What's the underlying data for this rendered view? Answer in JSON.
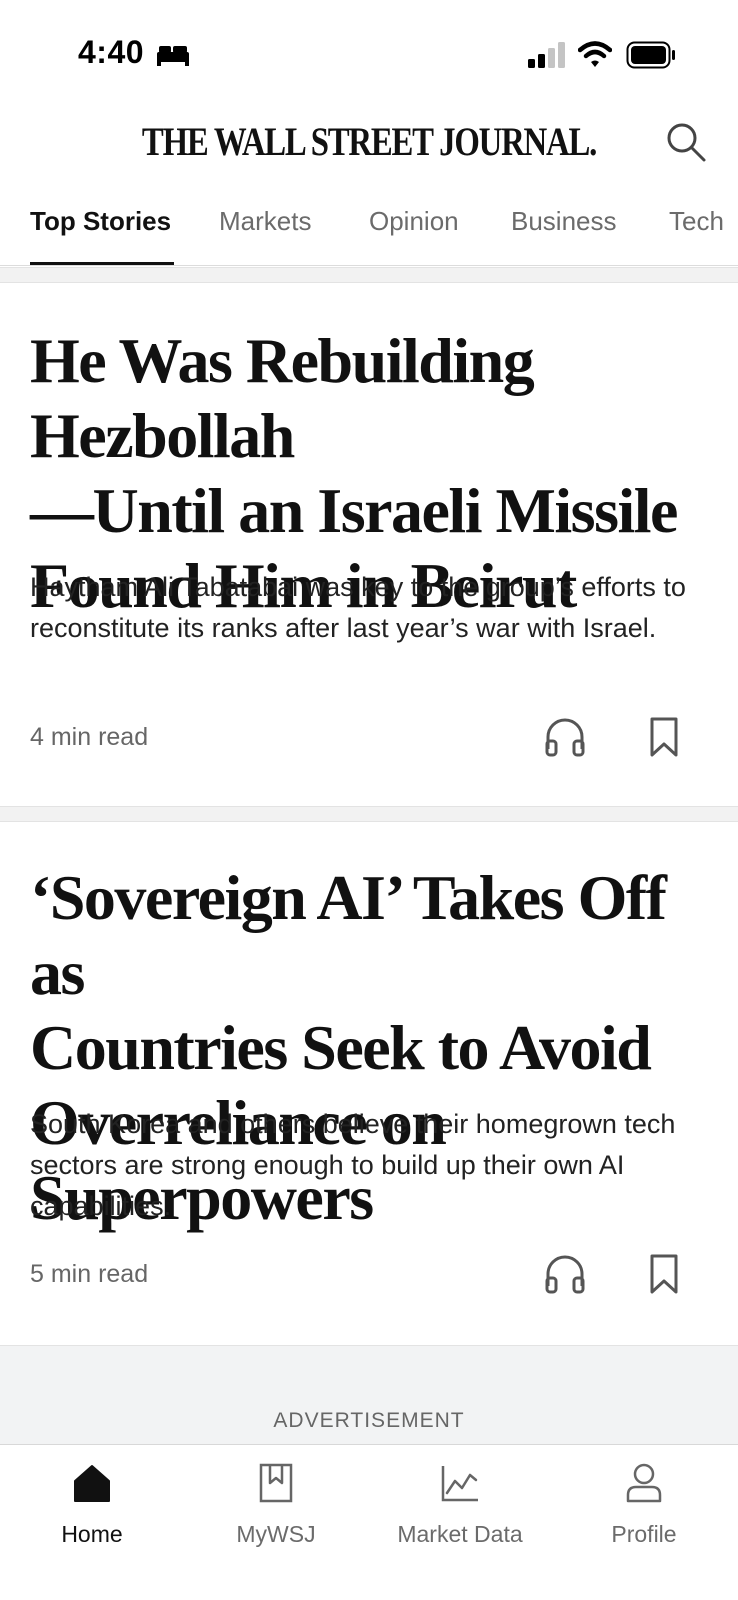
{
  "status_bar": {
    "time": "4:40",
    "icons": [
      "bed-icon",
      "cellular-signal-icon",
      "wifi-icon",
      "battery-icon"
    ]
  },
  "header": {
    "logo_text": "THE WALL STREET JOURNAL.",
    "search_icon": "search-icon"
  },
  "tabs": [
    {
      "label": "Top Stories",
      "active": true
    },
    {
      "label": "Markets",
      "active": false
    },
    {
      "label": "Opinion",
      "active": false
    },
    {
      "label": "Business",
      "active": false
    },
    {
      "label": "Tech",
      "active": false
    }
  ],
  "articles": [
    {
      "headline_lines": [
        "He Was Rebuilding Hezbollah",
        "—Until an Israeli Missile",
        "Found Him in Beirut"
      ],
      "summary": "Haytham Ali Tabatabai was key to the group’s efforts to reconstitute its ranks after last year’s war with Israel.",
      "read_time": "4 min read"
    },
    {
      "headline_lines": [
        "‘Sovereign AI’ Takes Off as",
        "Countries Seek to Avoid",
        "Overreliance on Superpowers"
      ],
      "summary": "South Korea and others believe their homegrown tech sectors are strong enough to build up their own AI capabilities.",
      "read_time": "5 min read"
    }
  ],
  "ad": {
    "label": "ADVERTISEMENT"
  },
  "bottom_nav": [
    {
      "label": "Home",
      "icon": "home-icon",
      "active": true
    },
    {
      "label": "MyWSJ",
      "icon": "bookmark-icon",
      "active": false
    },
    {
      "label": "Market Data",
      "icon": "chart-icon",
      "active": false
    },
    {
      "label": "Profile",
      "icon": "person-icon",
      "active": false
    }
  ]
}
